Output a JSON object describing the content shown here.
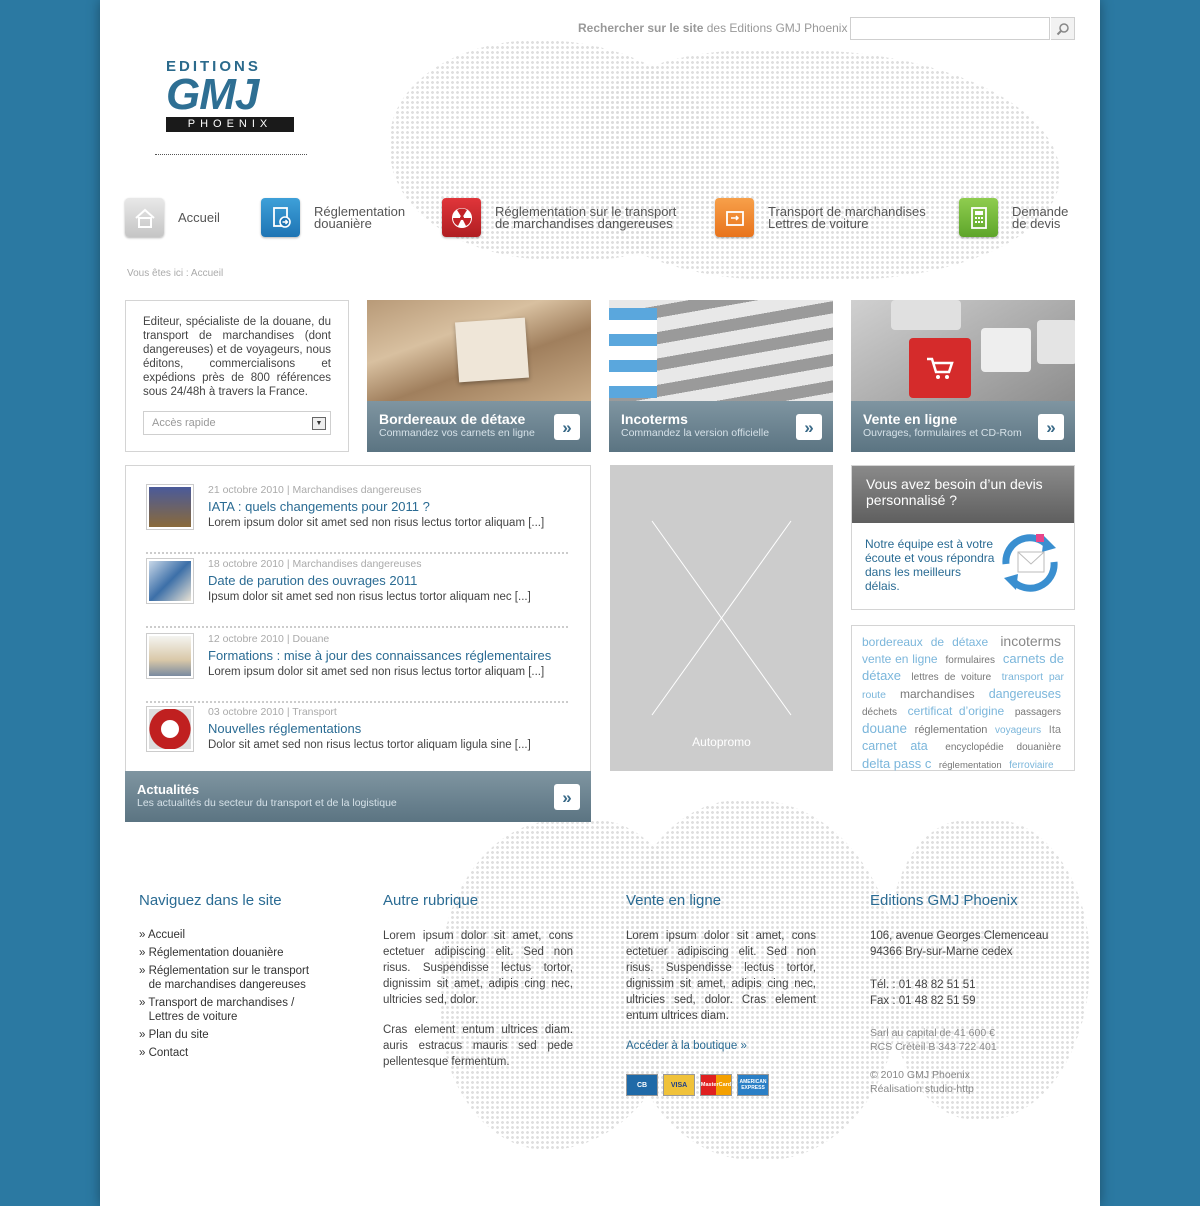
{
  "colors": {
    "background": "#2b79a2",
    "accent": "#2a6b93",
    "band": "#6b8390",
    "tag_light": "#7bb6db"
  },
  "search": {
    "label_bold": "Rechercher sur le site",
    "label_rest": " des Editions GMJ Phoenix",
    "value": ""
  },
  "logo": {
    "line1": "EDITIONS",
    "line2": "GMJ",
    "line3": "PHOENIX"
  },
  "nav": [
    {
      "label": "Accueil",
      "icon": "home-icon"
    },
    {
      "label": "Réglementation\ndouanière",
      "icon": "document-icon"
    },
    {
      "label": "Réglementation sur le transport\nde marchandises dangereuses",
      "icon": "radiation-icon"
    },
    {
      "label": "Transport de marchandises\nLettres de voiture",
      "icon": "package-icon"
    },
    {
      "label": "Demande\nde devis",
      "icon": "calculator-icon"
    }
  ],
  "breadcrumb": "Vous êtes ici : Accueil",
  "intro": {
    "text": "Editeur, spécialiste de la douane, du transport de marchandises (dont dangereuses) et de voyageurs, nous éditons, commercialisons et expédions près de 800 références sous 24/48h à travers la France.",
    "quick_access": "Accès rapide"
  },
  "tiles": [
    {
      "title": "Bordereaux de détaxe",
      "subtitle": "Commandez vos carnets en ligne"
    },
    {
      "title": "Incoterms",
      "subtitle": "Commandez la version officielle"
    },
    {
      "title": "Vente en ligne",
      "subtitle": "Ouvrages, formulaires et CD-Rom"
    }
  ],
  "news": {
    "items": [
      {
        "date": "21 octobre 2010",
        "category": "Marchandises dangereuses",
        "title": "IATA : quels changements pour 2011 ?",
        "excerpt": "Lorem ipsum dolor sit amet sed non risus lectus tortor aliquam [...]"
      },
      {
        "date": "18 octobre 2010",
        "category": "Marchandises dangereuses",
        "title": "Date de parution des ouvrages 2011",
        "excerpt": "Ipsum dolor sit amet sed non risus lectus tortor aliquam nec [...]"
      },
      {
        "date": "12 octobre 2010",
        "category": "Douane",
        "title": "Formations : mise à jour des connaissances réglementaires",
        "excerpt": "Lorem ipsum dolor sit amet sed non risus lectus tortor aliquam [...]"
      },
      {
        "date": "03 octobre 2010",
        "category": "Transport",
        "title": "Nouvelles réglementations",
        "excerpt": "Dolor sit amet sed non risus lectus tortor aliquam ligula sine [...]"
      }
    ],
    "band_title": "Actualités",
    "band_subtitle": "Les actualités du secteur du transport et de la logistique",
    "separator": "|"
  },
  "promo": {
    "label": "Autopromo"
  },
  "devis": {
    "heading": "Vous avez besoin d’un devis personnalisé ?",
    "body": "Notre équipe est à votre écoute et vous répondra dans les meilleurs délais."
  },
  "tags": [
    {
      "text": "bordereaux de détaxe",
      "size": 12,
      "color": "#7bb6db"
    },
    {
      "text": "incoterms",
      "size": 14,
      "color": "#888888"
    },
    {
      "text": "vente en ligne",
      "size": 12,
      "color": "#7bb6db"
    },
    {
      "text": "formulaires",
      "size": 10,
      "color": "#777777"
    },
    {
      "text": "carnets de détaxe",
      "size": 13,
      "color": "#7bb6db"
    },
    {
      "text": "lettres de voiture",
      "size": 10,
      "color": "#777777"
    },
    {
      "text": "transport par route",
      "size": 10.5,
      "color": "#7bb6db"
    },
    {
      "text": "marchandises",
      "size": 12,
      "color": "#777777"
    },
    {
      "text": "dangereuses",
      "size": 12.5,
      "color": "#7bb6db"
    },
    {
      "text": "déchets",
      "size": 10,
      "color": "#777777"
    },
    {
      "text": "certificat d’origine",
      "size": 12,
      "color": "#7bb6db"
    },
    {
      "text": "passagers",
      "size": 10,
      "color": "#777777"
    },
    {
      "text": "douane",
      "size": 13.5,
      "color": "#7bb6db"
    },
    {
      "text": "réglementation",
      "size": 11,
      "color": "#777777"
    },
    {
      "text": "voyageurs",
      "size": 10,
      "color": "#7bb6db"
    },
    {
      "text": "Ita",
      "size": 11,
      "color": "#888888"
    },
    {
      "text": "carnet ata",
      "size": 12.5,
      "color": "#7bb6db"
    },
    {
      "text": "encyclopédie douanière",
      "size": 10,
      "color": "#777777"
    },
    {
      "text": "delta pass c",
      "size": 13,
      "color": "#7bb6db"
    },
    {
      "text": "réglementation",
      "size": 9.5,
      "color": "#777777"
    },
    {
      "text": "ferroviaire",
      "size": 10,
      "color": "#7bb6db"
    }
  ],
  "footer": {
    "col1": {
      "heading": "Naviguez dans le site",
      "links": [
        "» Accueil",
        "» Réglementation douanière",
        "» Réglementation sur le transport\n   de marchandises dangereuses",
        "» Transport de marchandises /\n   Lettres de voiture",
        "» Plan du site",
        "» Contact"
      ]
    },
    "col2": {
      "heading": "Autre rubrique",
      "p1": "Lorem ipsum dolor sit amet, cons ectetuer adipiscing elit. Sed non risus. Suspendisse lectus tortor, dignissim sit amet, adipis cing nec, ultricies sed, dolor.",
      "p2": "Cras element entum ultrices diam. auris estracus mauris sed pede pellentesque fermentum."
    },
    "col3": {
      "heading": "Vente en ligne",
      "p1": "Lorem ipsum dolor sit amet, cons ectetuer adipiscing elit. Sed non risus. Suspendisse lectus tortor, dignissim sit amet, adipis cing nec, ultricies sed, dolor. Cras element entum ultrices diam.",
      "link": "Accéder à la boutique »",
      "cards": [
        "CB",
        "VISA",
        "MasterCard",
        "AMERICAN EXPRESS"
      ]
    },
    "col4": {
      "heading": "Editions GMJ Phoenix",
      "address1": "106, avenue Georges Clemenceau",
      "address2": "94366 Bry-sur-Marne cedex",
      "tel": "Tél. : 01 48 82 51 51",
      "fax": "Fax : 01 48 82 51 59",
      "legal1": "Sarl au capital de 41 600 €",
      "legal2": "RCS Créteil B 343 722 401",
      "copy1": "© 2010 GMJ Phoenix",
      "copy2": "Réalisation studio-http"
    }
  }
}
